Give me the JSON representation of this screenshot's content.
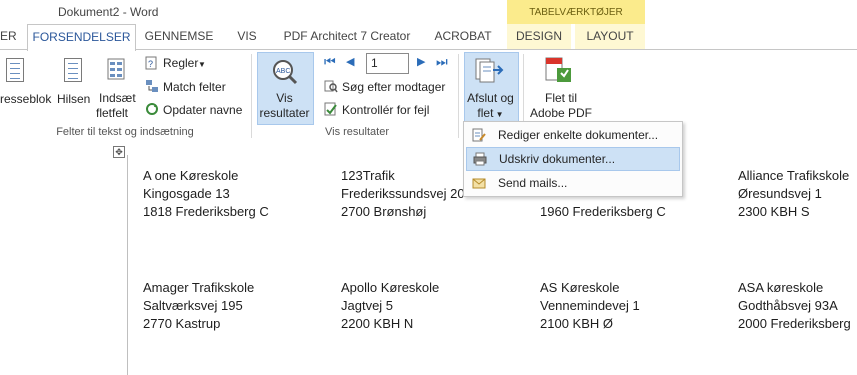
{
  "window": {
    "title": "Dokument2 - Word"
  },
  "contextual_tab_group": {
    "label": "TABELVÆRKTØJER",
    "color": "#fbeb8c"
  },
  "tabs": {
    "partial_left": "ER",
    "mailings": "FORSENDELSER",
    "review": "GENNEMSE",
    "view": "VIS",
    "pdf": "PDF Architect 7 Creator",
    "acrobat": "ACROBAT",
    "design": "DESIGN",
    "layout": "LAYOUT"
  },
  "ribbon": {
    "fields_group": {
      "address_block": "resseblok",
      "greeting": "Hilsen",
      "insert_field_line1": "Indsæt",
      "insert_field_line2": "fletfelt",
      "rules": "Regler",
      "match_fields": "Match felter",
      "update_labels": "Opdater navne",
      "group_label": "Felter til tekst og indsætning"
    },
    "preview_group": {
      "preview_line1": "Vis",
      "preview_line2": "resultater",
      "record_number": "1",
      "find_recipient": "Søg efter modtager",
      "check_errors": "Kontrollér for fejl",
      "group_label": "Vis resultater"
    },
    "finish_group": {
      "finish_line1": "Afslut og",
      "finish_line2": "flet"
    },
    "adobe_group": {
      "merge_line1": "Flet til",
      "merge_line2": "Adobe PDF"
    }
  },
  "finish_menu": {
    "items": [
      "Rediger enkelte dokumenter...",
      "Udskriv dokumenter...",
      "Send mails..."
    ]
  },
  "labels": [
    [
      "A one Køreskole",
      "Kingosgade 13",
      "1818 Frederiksberg C"
    ],
    [
      "123Trafik",
      "Frederikssundsvej 20",
      "2700 Brønshøj"
    ],
    [
      "",
      "",
      "1960 Frederiksberg C"
    ],
    [
      "Alliance Trafikskole",
      "Øresundsvej 1",
      "2300 KBH S"
    ],
    [
      "Amager Trafikskole",
      "Saltværksvej 195",
      "2770 Kastrup"
    ],
    [
      "Apollo Køreskole",
      "Jagtvej 5",
      "2200 KBH N"
    ],
    [
      "AS Køreskole",
      "Vennemindevej 1",
      "2100 KBH Ø"
    ],
    [
      "ASA køreskole",
      "Godthåbsvej 93A",
      "2000 Frederiksberg"
    ]
  ]
}
